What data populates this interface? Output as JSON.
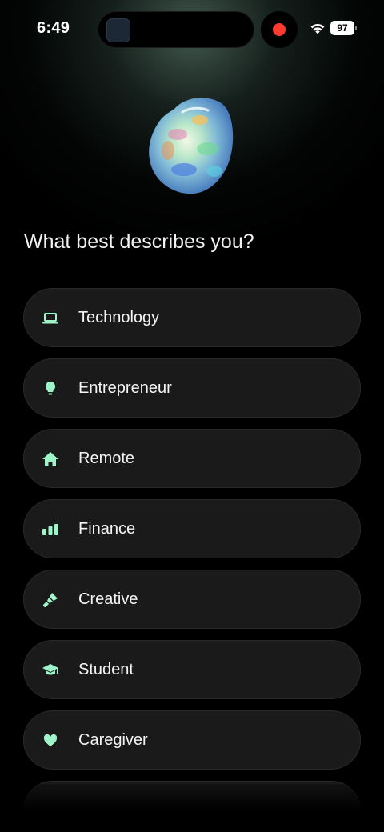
{
  "status_bar": {
    "time": "6:49",
    "battery": "97",
    "recording_color": "#ff3b30"
  },
  "hero": {
    "image": "opal-gem",
    "question": "What best describes you?"
  },
  "accent_color": "#9ff5c9",
  "options": [
    {
      "label": "Technology",
      "icon": "laptop-icon"
    },
    {
      "label": "Entrepreneur",
      "icon": "lightbulb-icon"
    },
    {
      "label": "Remote",
      "icon": "house-icon"
    },
    {
      "label": "Finance",
      "icon": "bar-chart-icon"
    },
    {
      "label": "Creative",
      "icon": "paintbrush-icon"
    },
    {
      "label": "Student",
      "icon": "graduation-cap-icon"
    },
    {
      "label": "Caregiver",
      "icon": "heart-icon"
    }
  ]
}
